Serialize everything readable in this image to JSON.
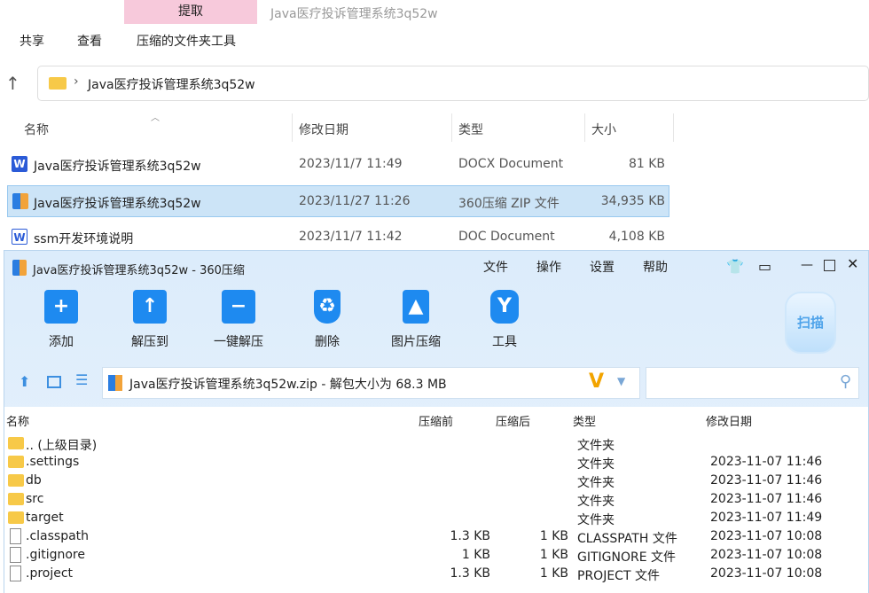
{
  "explorer": {
    "ribbon_tab": "提取",
    "window_title": "Java医疗投诉管理系统3q52w",
    "menu": [
      "共享",
      "查看",
      "压缩的文件夹工具"
    ],
    "breadcrumb": "Java医疗投诉管理系统3q52w",
    "columns": [
      "名称",
      "修改日期",
      "类型",
      "大小"
    ],
    "rows": [
      {
        "name": "Java医疗投诉管理系统3q52w",
        "date": "2023/11/7 11:49",
        "type": "DOCX Document",
        "size": "81 KB",
        "icon": "W"
      },
      {
        "name": "Java医疗投诉管理系统3q52w",
        "date": "2023/11/27 11:26",
        "type": "360压缩 ZIP 文件",
        "size": "34,935 KB",
        "icon": "Z"
      },
      {
        "name": "ssm开发环境说明",
        "date": "2023/11/7 11:42",
        "type": "DOC Document",
        "size": "4,108 KB",
        "icon": "W"
      }
    ]
  },
  "zip": {
    "title": "Java医疗投诉管理系统3q52w - 360压缩",
    "menu": [
      "文件",
      "操作",
      "设置",
      "帮助"
    ],
    "toolbar": [
      {
        "label": "添加",
        "glyph": "+"
      },
      {
        "label": "解压到",
        "glyph": "↑"
      },
      {
        "label": "一键解压",
        "glyph": "−"
      },
      {
        "label": "删除",
        "glyph": "♻"
      },
      {
        "label": "图片压缩",
        "glyph": "▲"
      },
      {
        "label": "工具",
        "glyph": "Y"
      }
    ],
    "scan_label": "扫描",
    "path": "Java医疗投诉管理系统3q52w.zip - 解包大小为 68.3 MB",
    "columns": [
      "名称",
      "压缩前",
      "压缩后",
      "类型",
      "修改日期"
    ],
    "rows": [
      {
        "name": ".. (上级目录)",
        "before": "",
        "after": "",
        "type": "文件夹",
        "date": "",
        "kind": "folder"
      },
      {
        "name": ".settings",
        "before": "",
        "after": "",
        "type": "文件夹",
        "date": "2023-11-07 11:46",
        "kind": "folder"
      },
      {
        "name": "db",
        "before": "",
        "after": "",
        "type": "文件夹",
        "date": "2023-11-07 11:46",
        "kind": "folder"
      },
      {
        "name": "src",
        "before": "",
        "after": "",
        "type": "文件夹",
        "date": "2023-11-07 11:46",
        "kind": "folder"
      },
      {
        "name": "target",
        "before": "",
        "after": "",
        "type": "文件夹",
        "date": "2023-11-07 11:49",
        "kind": "folder"
      },
      {
        "name": ".classpath",
        "before": "1.3 KB",
        "after": "1 KB",
        "type": "CLASSPATH 文件",
        "date": "2023-11-07 10:08",
        "kind": "file"
      },
      {
        "name": ".gitignore",
        "before": "1 KB",
        "after": "1 KB",
        "type": "GITIGNORE 文件",
        "date": "2023-11-07 10:08",
        "kind": "file"
      },
      {
        "name": ".project",
        "before": "1.3 KB",
        "after": "1 KB",
        "type": "PROJECT 文件",
        "date": "2023-11-07 10:08",
        "kind": "file"
      }
    ]
  }
}
